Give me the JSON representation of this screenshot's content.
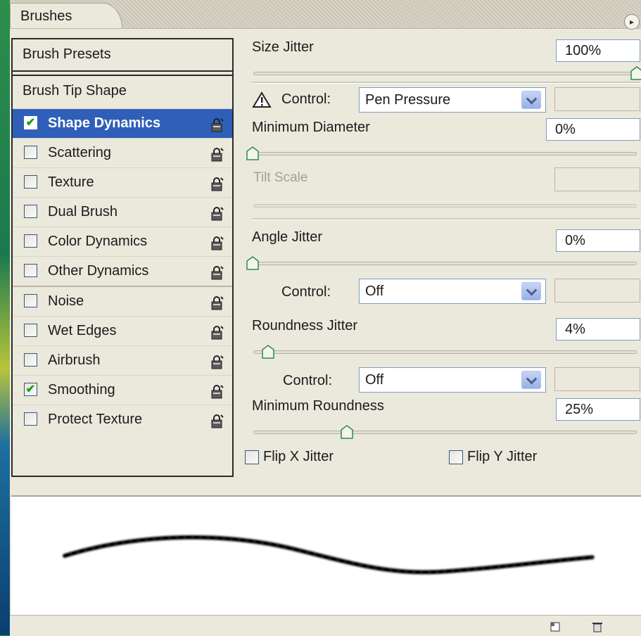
{
  "panel": {
    "tab_title": "Brushes",
    "menu_icon": "flyout-arrow-icon"
  },
  "list": {
    "presets_label": "Brush Presets",
    "tip_label": "Brush Tip Shape",
    "items": [
      {
        "label": "Shape Dynamics",
        "checked": true,
        "selected": true
      },
      {
        "label": "Scattering",
        "checked": false
      },
      {
        "label": "Texture",
        "checked": false
      },
      {
        "label": "Dual Brush",
        "checked": false
      },
      {
        "label": "Color Dynamics",
        "checked": false
      },
      {
        "label": "Other Dynamics",
        "checked": false
      },
      {
        "label": "Noise",
        "checked": false
      },
      {
        "label": "Wet Edges",
        "checked": false
      },
      {
        "label": "Airbrush",
        "checked": false
      },
      {
        "label": "Smoothing",
        "checked": true
      },
      {
        "label": "Protect Texture",
        "checked": false
      }
    ],
    "check_glyph": "✔"
  },
  "settings": {
    "size_jitter": {
      "label": "Size Jitter",
      "value": "100%",
      "slider": 1.0
    },
    "size_control": {
      "label": "Control:",
      "value": "Pen Pressure",
      "warning_icon": "warning-triangle-icon"
    },
    "min_diameter": {
      "label": "Minimum Diameter",
      "value": "0%",
      "slider": 0.0
    },
    "tilt_scale": {
      "label": "Tilt Scale",
      "value": "",
      "disabled": true
    },
    "angle_jitter": {
      "label": "Angle Jitter",
      "value": "0%",
      "slider": 0.0
    },
    "angle_control": {
      "label": "Control:",
      "value": "Off"
    },
    "roundness_jitter": {
      "label": "Roundness Jitter",
      "value": "4%",
      "slider": 0.04
    },
    "roundness_control": {
      "label": "Control:",
      "value": "Off"
    },
    "min_roundness": {
      "label": "Minimum Roundness",
      "value": "25%",
      "slider": 0.25
    },
    "flip_x": {
      "label": "Flip X Jitter",
      "checked": false
    },
    "flip_y": {
      "label": "Flip Y Jitter",
      "checked": false
    }
  },
  "bottom": {
    "icons": [
      "new-preset-icon",
      "trash-icon"
    ]
  },
  "colors": {
    "panel_bg": "#ebe9dc",
    "selection": "#2f5fb8",
    "check_green": "#1f9a1f"
  }
}
